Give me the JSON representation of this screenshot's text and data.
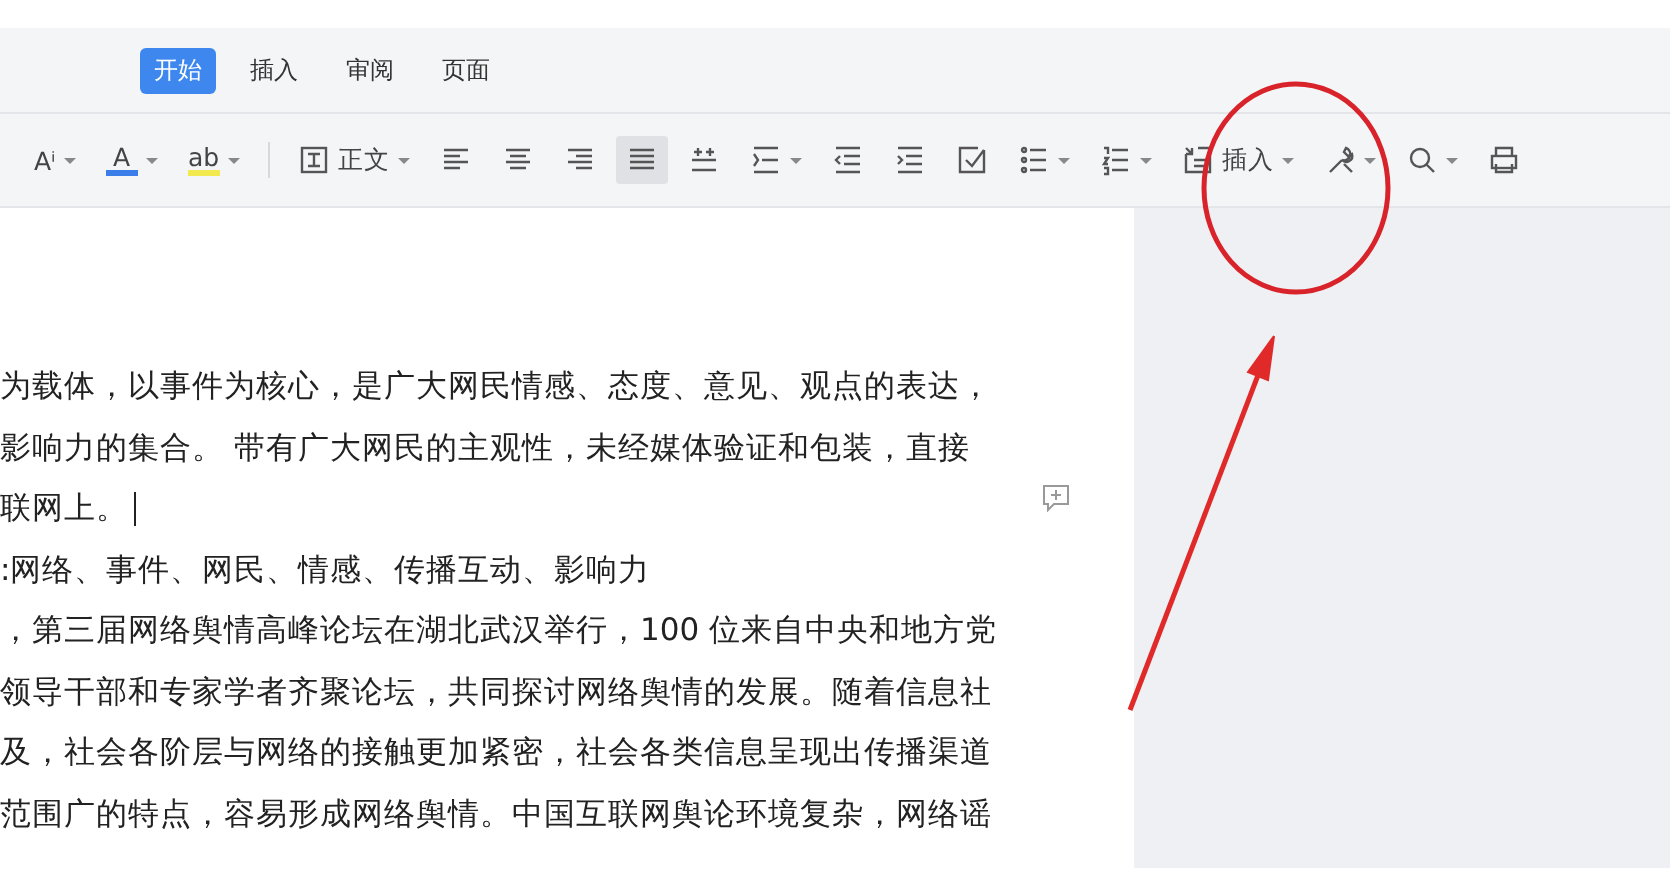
{
  "tabs": [
    {
      "label": "开始",
      "selected": true
    },
    {
      "label": "插入",
      "selected": false
    },
    {
      "label": "审阅",
      "selected": false
    },
    {
      "label": "页面",
      "selected": false
    }
  ],
  "toolbar": [
    {
      "kind": "font-size",
      "text": "Aⁱ",
      "dropdown": true,
      "selected": false
    },
    {
      "kind": "font-color",
      "text": "A",
      "color": "#3b7de9",
      "dropdown": true,
      "selected": false
    },
    {
      "kind": "highlight",
      "text": "ab",
      "color": "#f2e94e",
      "dropdown": true,
      "selected": false
    },
    {
      "kind": "divider"
    },
    {
      "kind": "style",
      "text": "正文",
      "dropdown": true,
      "selected": false
    },
    {
      "kind": "align-left",
      "dropdown": false,
      "selected": false
    },
    {
      "kind": "align-center",
      "dropdown": false,
      "selected": false
    },
    {
      "kind": "align-right",
      "dropdown": false,
      "selected": false
    },
    {
      "kind": "justify",
      "dropdown": false,
      "selected": true
    },
    {
      "kind": "line-spacing",
      "dropdown": false,
      "selected": false
    },
    {
      "kind": "paragraph-spacing",
      "dropdown": true,
      "selected": false
    },
    {
      "kind": "outdent",
      "dropdown": false,
      "selected": false
    },
    {
      "kind": "indent",
      "dropdown": false,
      "selected": false
    },
    {
      "kind": "checkbox",
      "dropdown": false,
      "selected": false
    },
    {
      "kind": "bullets",
      "dropdown": true,
      "selected": false
    },
    {
      "kind": "numbering",
      "dropdown": true,
      "selected": false
    },
    {
      "kind": "insert",
      "text": "插入",
      "dropdown": true,
      "selected": false
    },
    {
      "kind": "tools",
      "dropdown": true,
      "selected": false
    },
    {
      "kind": "search",
      "dropdown": true,
      "selected": false
    },
    {
      "kind": "print",
      "dropdown": false,
      "selected": false
    }
  ],
  "document": {
    "lines": [
      {
        "text": "为载体，以事件为核心，是广大网民情感、态度、意见、观点的表达，",
        "cursor": false
      },
      {
        "text": "影响力的集合。 带有广大网民的主观性，未经媒体验证和包装，直接",
        "cursor": false
      },
      {
        "text": "联网上。",
        "cursor": true
      },
      {
        "text": ":网络、事件、网民、情感、传播互动、影响力",
        "cursor": false
      },
      {
        "text": "，第三届网络舆情高峰论坛在湖北武汉举行，100 位来自中央和地方党",
        "cursor": false
      },
      {
        "text": "领导干部和专家学者齐聚论坛，共同探讨网络舆情的发展。随着信息社",
        "cursor": false
      },
      {
        "text": "及，社会各阶层与网络的接触更加紧密，社会各类信息呈现出传播渠道",
        "cursor": false
      },
      {
        "text": "范围广的特点，容易形成网络舆情。中国互联网舆论环境复杂，网络谣",
        "cursor": false
      }
    ]
  }
}
